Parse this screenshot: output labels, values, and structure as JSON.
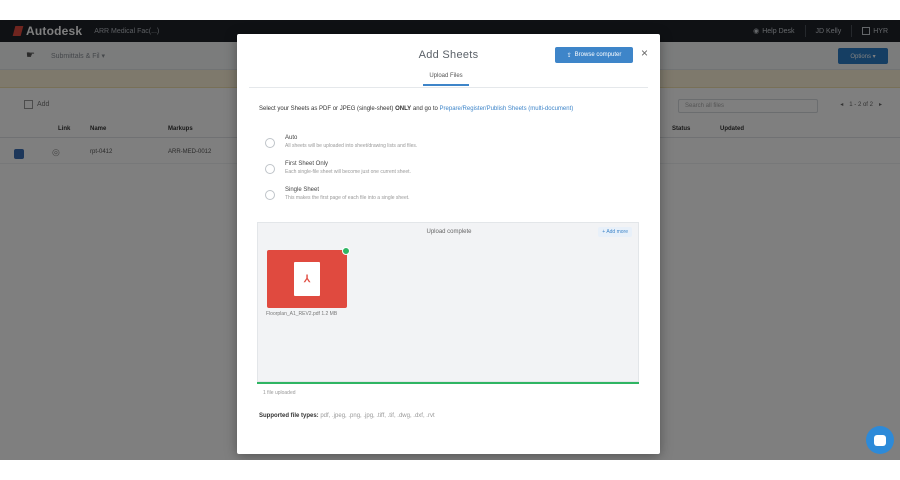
{
  "app": {
    "logo_text": "Autodesk",
    "project": "ARR Medical Fac(...)",
    "topbar": {
      "help": "Help Desk",
      "user": "JD Kelly",
      "account": "HYR"
    }
  },
  "subheader": {
    "breadcrumb": "Submittals & Fil ▾",
    "options_label": "Options ▾"
  },
  "toolbar": {
    "add_label": "Add",
    "search_placeholder": "Search all files",
    "pager": "1 - 2 of 2"
  },
  "table": {
    "columns": [
      "Link",
      "Name",
      "Markups",
      "Status",
      "Updated"
    ],
    "row": {
      "name": "rpt-0412",
      "markups": "ARR-MED-0012",
      "status": "",
      "updated": ""
    }
  },
  "modal": {
    "title": "Add Sheets",
    "browse_label": "Browse computer",
    "close_glyph": "×",
    "tab_label": "Upload Files",
    "instructions_pre": "Select your Sheets as PDF or JPEG (single-sheet) ",
    "instructions_bold": "ONLY",
    "instructions_mid": " and go to ",
    "instructions_link": "Prepare/Register/Publish Sheets (multi-document)",
    "options": [
      {
        "title": "Auto",
        "desc": "All sheets will be uploaded into sheet/drawing lists and files."
      },
      {
        "title": "First Sheet Only",
        "desc": "Each single-file sheet will become just one current sheet."
      },
      {
        "title": "Single Sheet",
        "desc": "This makes the first page of each file into a single sheet."
      }
    ],
    "dropzone": {
      "status": "Upload complete",
      "add_more": "+ Add more",
      "file_name": "Floorplan_A1_REV2.pdf 1.2 MB",
      "pdf_glyph": "⅄"
    },
    "upload_meta": "1 file uploaded",
    "supported_label": "Supported file types:",
    "supported_exts": " pdf, .jpeg, .png, .jpg, .tiff, .tif, .dwg, .dxf, .rvt"
  }
}
